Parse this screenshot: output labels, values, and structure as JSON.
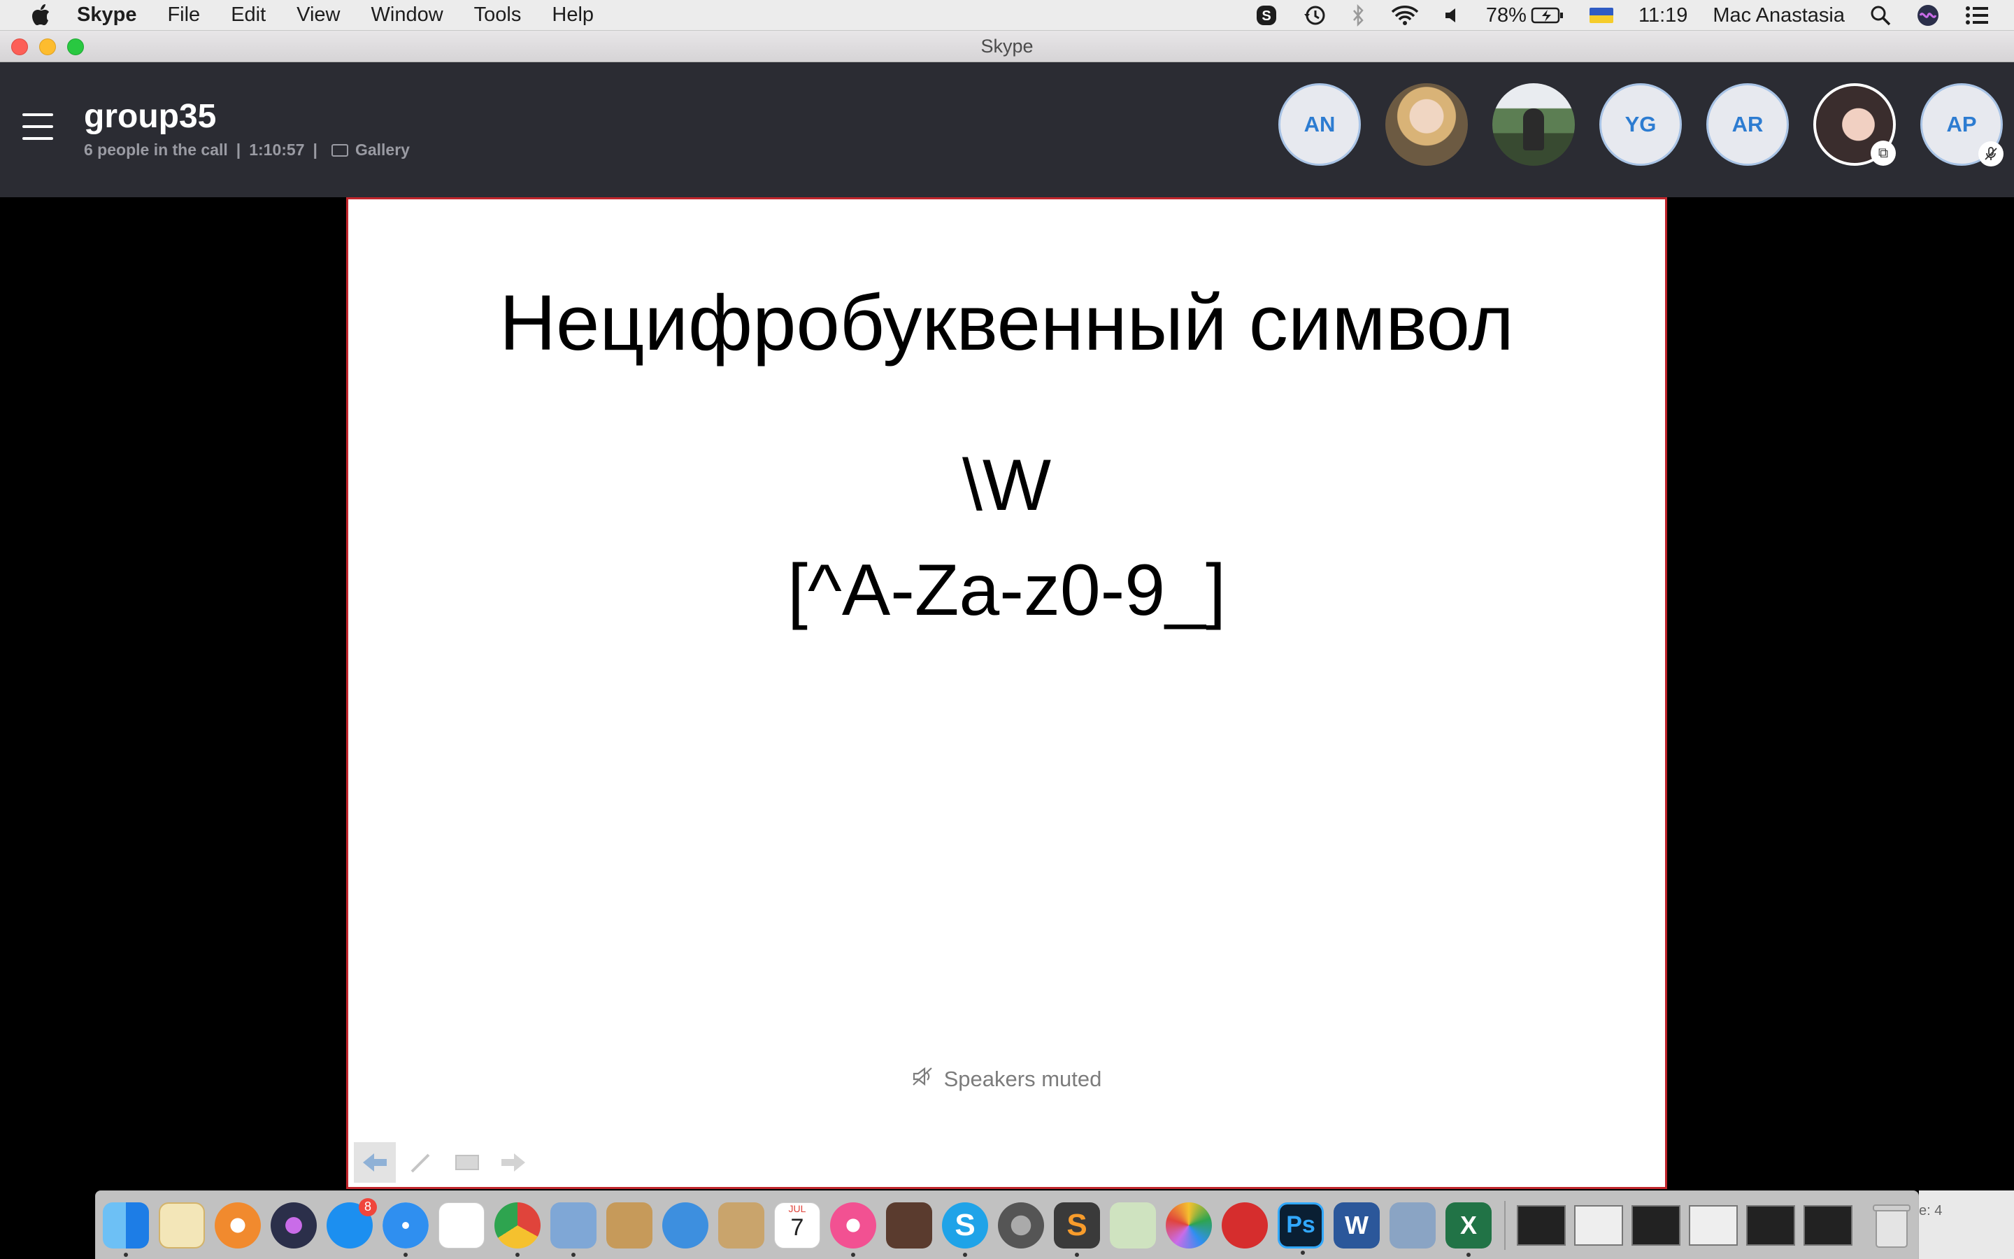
{
  "menubar": {
    "app_name": "Skype",
    "items": [
      "File",
      "Edit",
      "View",
      "Window",
      "Tools",
      "Help"
    ],
    "battery": "78%",
    "time": "11:19",
    "user": "Mac Anastasia"
  },
  "window": {
    "title": "Skype"
  },
  "call": {
    "group_name": "group35",
    "participants_text": "6 people in the call",
    "duration": "1:10:57",
    "separator": "|",
    "view_mode": "Gallery",
    "participants": [
      {
        "type": "initials",
        "label": "AN"
      },
      {
        "type": "photo"
      },
      {
        "type": "photo"
      },
      {
        "type": "initials",
        "label": "YG"
      },
      {
        "type": "initials",
        "label": "AR"
      },
      {
        "type": "photo",
        "badge": "screen-share-icon"
      },
      {
        "type": "initials",
        "label": "AP",
        "badge": "muted-mic-icon"
      }
    ]
  },
  "slide": {
    "title": "Нецифробуквенный символ",
    "line1": "\\W",
    "line2": "[^A-Za-z0-9_]",
    "status": "Speakers muted"
  },
  "dock": {
    "appstore_badge": "8",
    "calendar_month": "JUL",
    "calendar_day": "7",
    "peek_text": "e: 4"
  },
  "colors": {
    "header_bg": "#2b2c33",
    "accent": "#2d7cd1",
    "slide_border": "#c0262c"
  }
}
